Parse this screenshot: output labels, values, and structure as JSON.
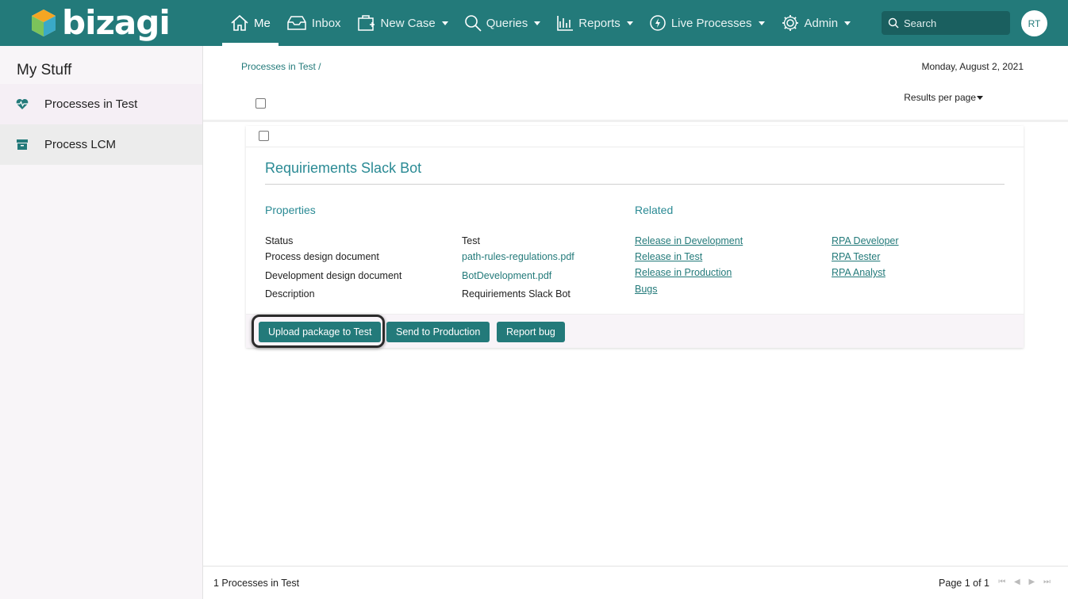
{
  "app": {
    "logo_text": "bizagi",
    "colors": {
      "brand": "#237a7a",
      "accent": "#2a8a94",
      "sidebar_bg": "#f8f5f8"
    }
  },
  "nav": {
    "items": [
      {
        "label": "Me",
        "icon": "home-icon",
        "active": true,
        "dropdown": false
      },
      {
        "label": "Inbox",
        "icon": "inbox-icon",
        "active": false,
        "dropdown": false
      },
      {
        "label": "New Case",
        "icon": "new-case-icon",
        "active": false,
        "dropdown": true
      },
      {
        "label": "Queries",
        "icon": "search-icon",
        "active": false,
        "dropdown": true
      },
      {
        "label": "Reports",
        "icon": "chart-icon",
        "active": false,
        "dropdown": true
      },
      {
        "label": "Live Processes",
        "icon": "lightning-icon",
        "active": false,
        "dropdown": true
      },
      {
        "label": "Admin",
        "icon": "gear-icon",
        "active": false,
        "dropdown": true
      }
    ],
    "search_placeholder": "Search",
    "avatar_initials": "RT"
  },
  "sidebar": {
    "title": "My Stuff",
    "items": [
      {
        "label": "Processes in Test",
        "icon": "heart-pulse-icon"
      },
      {
        "label": "Process LCM",
        "icon": "archive-icon"
      }
    ]
  },
  "main": {
    "breadcrumb": "Processes in Test /",
    "date": "Monday, August 2, 2021",
    "results_per_page": "Results per page",
    "card": {
      "title": "Requiriements Slack Bot",
      "properties_heading": "Properties",
      "related_heading": "Related",
      "properties": [
        {
          "label": "Status",
          "value": "Test",
          "is_link": false
        },
        {
          "label": "Process design document",
          "value": "path-rules-regulations.pdf",
          "is_link": true
        },
        {
          "label": "Development design document",
          "value": "BotDevelopment.pdf",
          "is_link": true
        },
        {
          "label": "Description",
          "value": "Requiriements Slack Bot",
          "is_link": false
        }
      ],
      "related_left": [
        "Release in Development",
        "Release in Test",
        "Release in Production",
        "Bugs"
      ],
      "related_right": [
        "RPA Developer",
        "RPA Tester",
        "RPA Analyst"
      ],
      "actions": [
        "Upload package to Test",
        "Send to Production",
        "Report bug"
      ]
    },
    "footer": {
      "count": "1 Processes in Test",
      "page": "Page 1 of 1",
      "pager_glyphs": "⏮ ◀ ▶ ⏭"
    }
  }
}
